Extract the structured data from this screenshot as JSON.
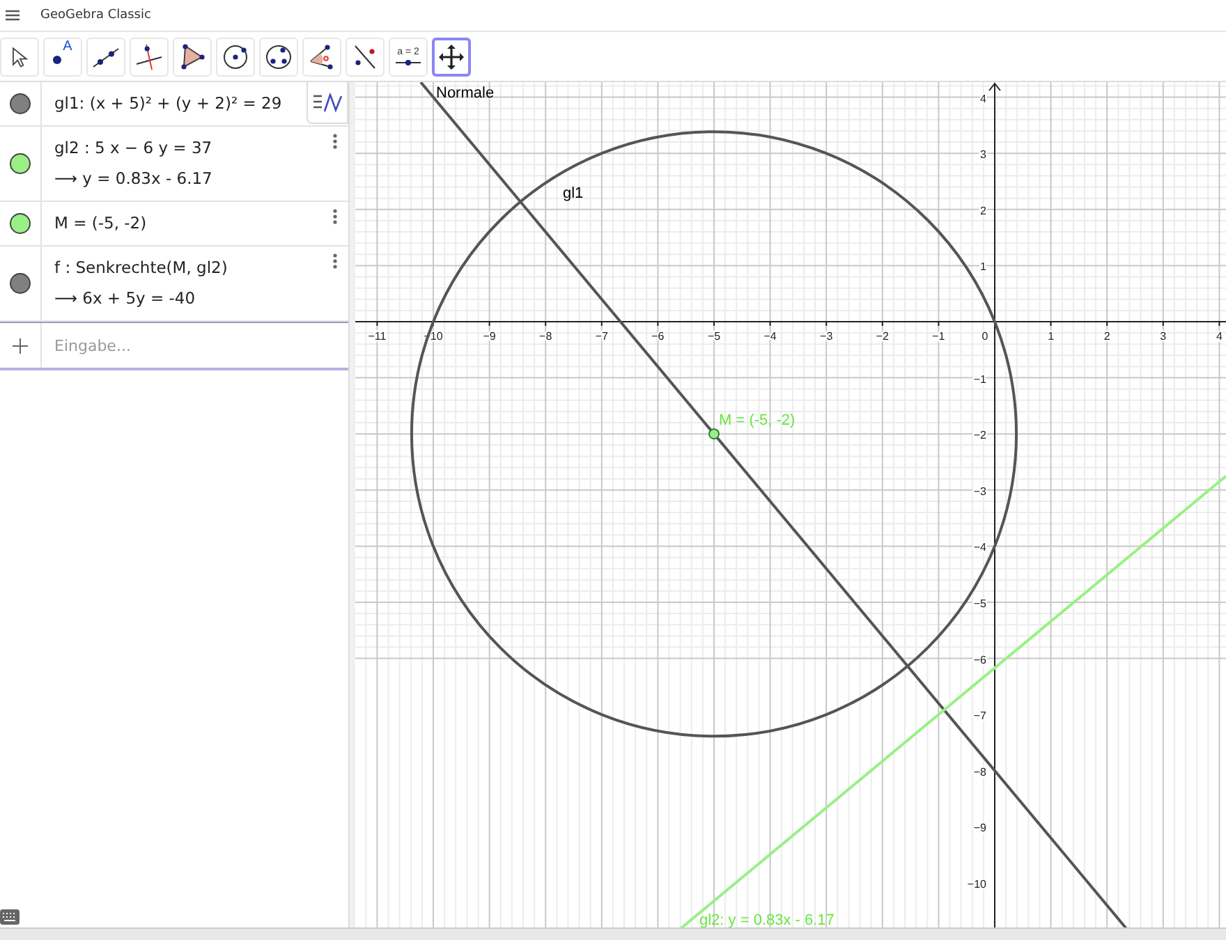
{
  "window": {
    "title": "GeoGebra Classic"
  },
  "toolbar": {
    "tools": [
      {
        "selected": false
      },
      {
        "selected": false,
        "label": "A"
      },
      {
        "selected": false
      },
      {
        "selected": false
      },
      {
        "selected": false
      },
      {
        "selected": false
      },
      {
        "selected": false
      },
      {
        "selected": false
      },
      {
        "selected": false
      },
      {
        "selected": false,
        "label": "a = 2"
      },
      {
        "selected": true
      }
    ]
  },
  "algebra": {
    "items": [
      {
        "color": "#808080",
        "definition": "gl1: (x + 5)² + (y + 2)² = 29"
      },
      {
        "color": "#99f086",
        "definition": "gl2 : 5 x − 6 y = 37",
        "output": "⟶  y = 0.83x - 6.17"
      },
      {
        "color": "#99f086",
        "definition": "M = (-5, -2)"
      },
      {
        "color": "#808080",
        "definition": "f : Senkrechte(M, gl2)",
        "output": "⟶  6x + 5y = -40"
      }
    ],
    "input": {
      "placeholder": "Eingabe..."
    }
  },
  "graphics": {
    "x_tick_labels": [
      "−11",
      "−10",
      "−9",
      "−8",
      "−7",
      "−6",
      "−5",
      "−4",
      "−3",
      "−2",
      "−1",
      "0",
      "1",
      "2",
      "3",
      "4"
    ],
    "y_tick_labels": [
      "4",
      "3",
      "2",
      "1",
      "−1",
      "−2",
      "−3",
      "−4",
      "−5",
      "−6",
      "−7",
      "−8",
      "−9",
      "−10"
    ],
    "labels": [
      {
        "text": "Normale",
        "color": "#000000"
      },
      {
        "text": "gl1",
        "color": "#000000"
      },
      {
        "text": "M = (-5, -2)",
        "color": "#66e640"
      },
      {
        "text": "gl2: y = 0.83x - 6.17",
        "color": "#66e640"
      }
    ]
  }
}
